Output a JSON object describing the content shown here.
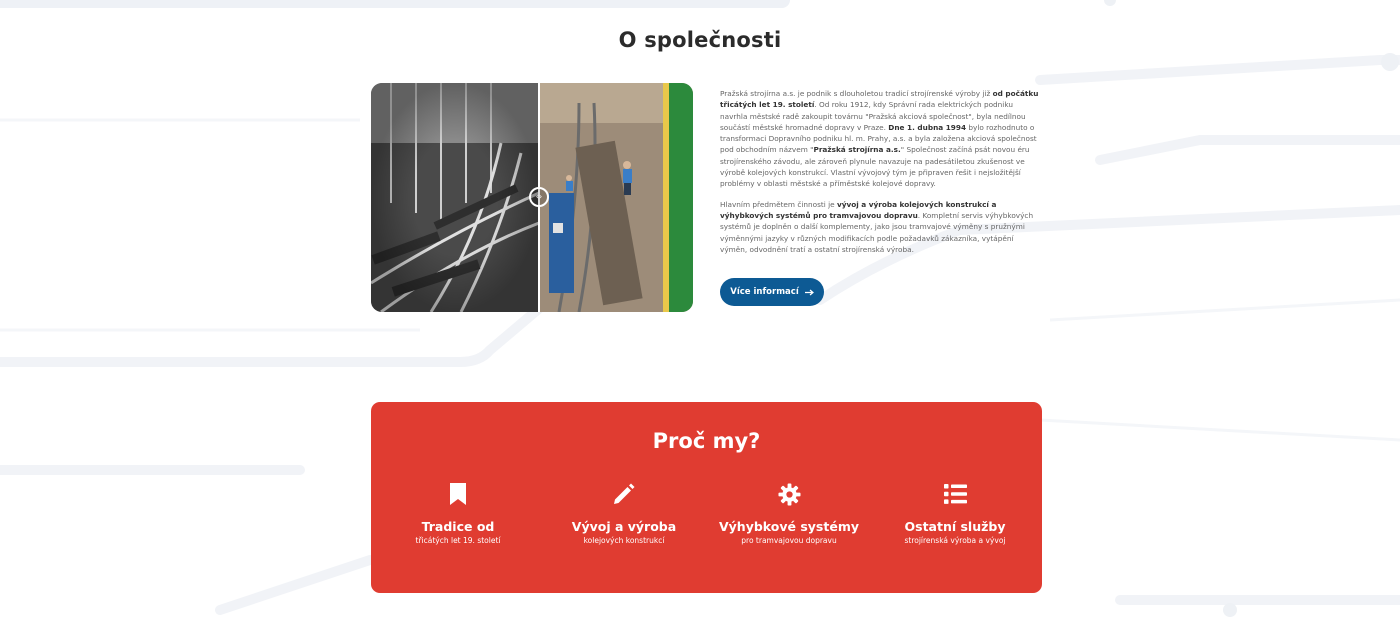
{
  "about": {
    "title": "O společnosti",
    "p1": [
      {
        "t": "Pražská strojírna a.s. je podnik s dlouholetou tradicí strojírenské výroby již ",
        "b": false
      },
      {
        "t": "od počátku třicátých let 19. století",
        "b": true
      },
      {
        "t": ". Od roku 1912, kdy Správní rada elektrických podniku navrhla městské radě zakoupit továrnu \"Pražská akciová společnost\", byla nedílnou součástí městské hromadné dopravy v Praze. ",
        "b": false
      },
      {
        "t": "Dne 1. dubna 1994",
        "b": true
      },
      {
        "t": " bylo rozhodnuto o transformaci Dopravního podniku hl. m. Prahy, a.s. a byla založena akciová společnost pod obchodním názvem \"",
        "b": false
      },
      {
        "t": "Pražská strojírna a.s.",
        "b": true
      },
      {
        "t": "\" Společnost začíná psát novou éru strojírenského závodu, ale zároveň plynule navazuje na padesátiletou zkušenost ve výrobě kolejových konstrukcí. Vlastní vývojový tým je připraven řešit i nejsložitější problémy v oblasti městské a příměstské kolejové dopravy.",
        "b": false
      }
    ],
    "p2": [
      {
        "t": "Hlavním předmětem činnosti je ",
        "b": false
      },
      {
        "t": "vývoj a výroba kolejových konstrukcí a výhybkových systémů pro tramvajovou dopravu",
        "b": true
      },
      {
        "t": ". Kompletní servis výhybkových systémů je doplněn o další komplementy, jako jsou tramvajové výměny s pružnými výměnnými jazyky v různých modifikacích podle požadavků zákazníka, vytápění výměn, odvodnění tratí a ostatní strojírenská výroba.",
        "b": false
      }
    ],
    "button_label": "Více informací",
    "button_icon": "arrow-right-icon",
    "compare_handle_icon": "compare-arrows-icon"
  },
  "why": {
    "title": "Proč my?",
    "items": [
      {
        "icon": "bookmark-icon",
        "title": "Tradice od",
        "subtitle": "třicátých let 19. století"
      },
      {
        "icon": "pencil-icon",
        "title": "Vývoj a výroba",
        "subtitle": "kolejových konstrukcí"
      },
      {
        "icon": "gear-icon",
        "title": "Výhybkové systémy",
        "subtitle": "pro tramvajovou dopravu"
      },
      {
        "icon": "list-icon",
        "title": "Ostatní služby",
        "subtitle": "strojírenská výroba a vývoj"
      }
    ]
  },
  "colors": {
    "primary_blue": "#0d5a94",
    "accent_red": "#e03c31",
    "heading": "#2b2b2b"
  }
}
